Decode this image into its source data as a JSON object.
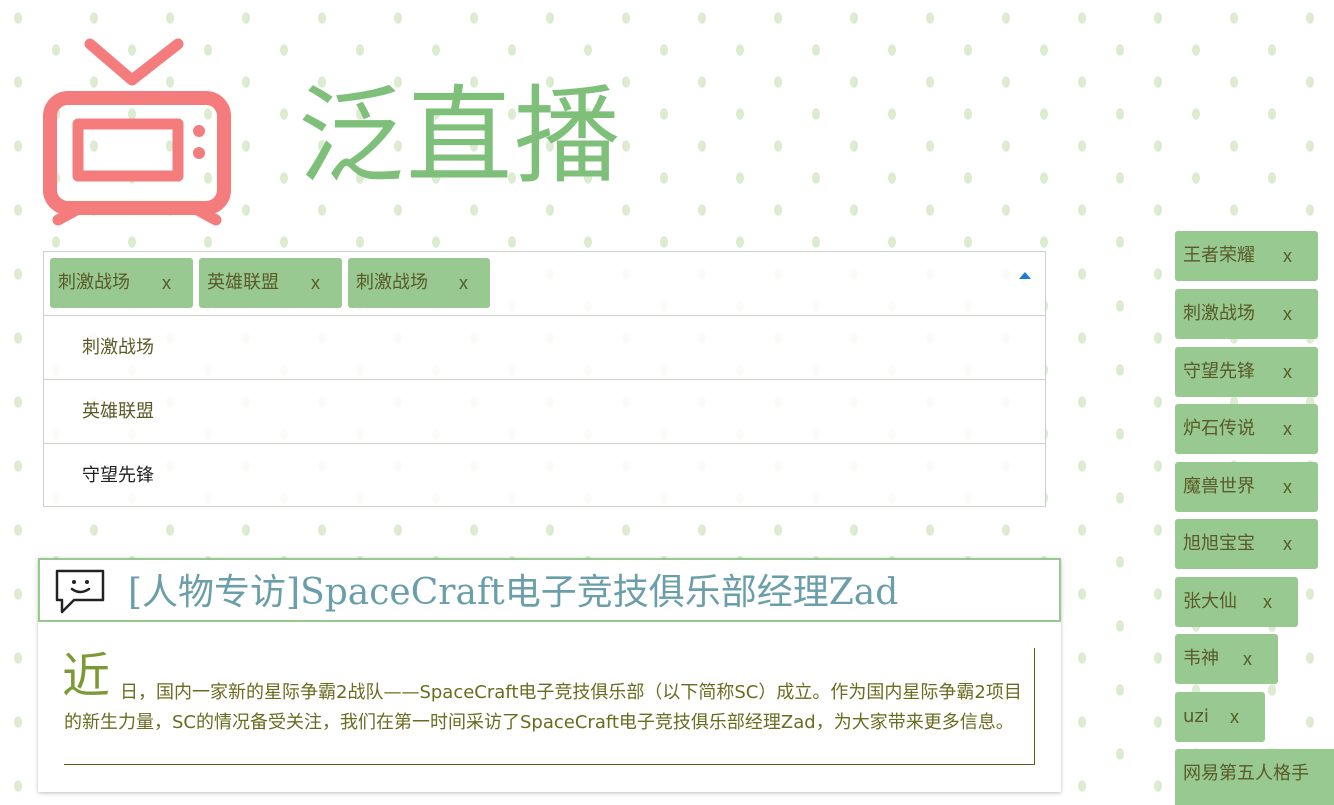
{
  "brand": {
    "name": "泛直播"
  },
  "select": {
    "chips": [
      {
        "label": "刺激战场",
        "close": "x"
      },
      {
        "label": "英雄联盟",
        "close": "x"
      },
      {
        "label": "刺激战场",
        "close": "x"
      }
    ],
    "options": [
      "刺激战场",
      "英雄联盟",
      "守望先锋"
    ]
  },
  "article": {
    "title": "[人物专访]SpaceCraft电子竞技俱乐部经理Zad",
    "dropcap": "近",
    "body": "日，国内一家新的星际争霸2战队——SpaceCraft电子竞技俱乐部（以下简称SC）成立。作为国内星际争霸2项目的新生力量，SC的情况备受关注，我们在第一时间采访了SpaceCraft电子竞技俱乐部经理Zad，为大家带来更多信息。"
  },
  "tags": [
    {
      "label": "王者荣耀",
      "close": "x"
    },
    {
      "label": "刺激战场",
      "close": "x"
    },
    {
      "label": "守望先锋",
      "close": "x"
    },
    {
      "label": "炉石传说",
      "close": "x"
    },
    {
      "label": "魔兽世界",
      "close": "x"
    },
    {
      "label": "旭旭宝宝",
      "close": "x"
    },
    {
      "label": "张大仙",
      "close": "x"
    },
    {
      "label": "韦神",
      "close": "x"
    },
    {
      "label": "uzi",
      "close": "x"
    },
    {
      "label": "网易第五人格手",
      "close": ""
    }
  ],
  "colors": {
    "accent": "#97c990",
    "logo": "#f47c7c",
    "brand": "#7ec07a",
    "title": "#6a9eaa"
  }
}
